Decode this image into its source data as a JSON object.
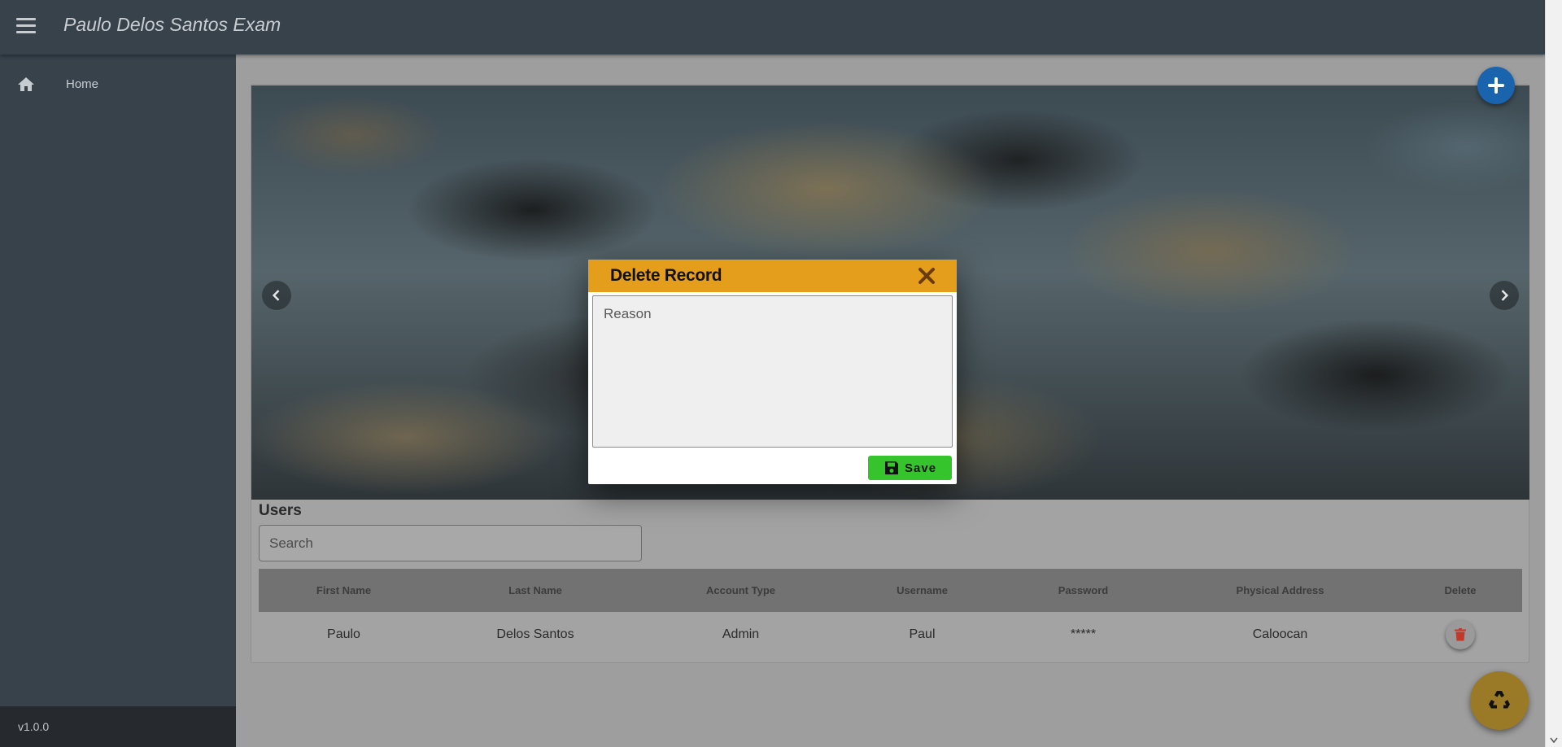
{
  "app": {
    "title": "Paulo Delos Santos Exam"
  },
  "sidebar": {
    "items": [
      {
        "label": "Home",
        "icon": "home-icon"
      }
    ],
    "version": "v1.0.0"
  },
  "users": {
    "title": "Users",
    "search_placeholder": "Search",
    "columns": [
      "First Name",
      "Last Name",
      "Account Type",
      "Username",
      "Password",
      "Physical Address",
      "Delete"
    ],
    "rows": [
      {
        "first_name": "Paulo",
        "last_name": "Delos Santos",
        "account_type": "Admin",
        "username": "Paul",
        "password": "*****",
        "address": "Caloocan"
      }
    ]
  },
  "dialog": {
    "title": "Delete Record",
    "reason_placeholder": "Reason",
    "save_label": "Save"
  },
  "colors": {
    "topbar": "#37424b",
    "dialog_header": "#e59d1c",
    "save_button": "#35c42c",
    "fab_add": "#1a64ad",
    "fab_recycle": "#9a7a26",
    "delete_icon": "#c0392b"
  }
}
